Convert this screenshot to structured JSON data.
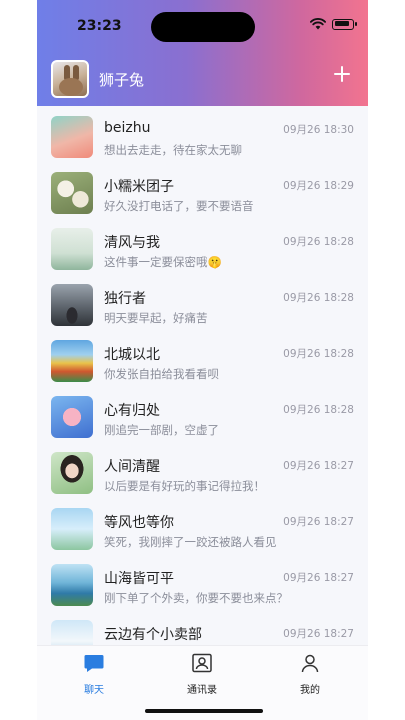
{
  "status_bar": {
    "time": "23:23"
  },
  "header": {
    "username": "狮子兔",
    "add_icon": "plus-icon"
  },
  "chats": [
    {
      "name": "beizhu",
      "time": "09月26 18:30",
      "message": "想出去走走，待在家太无聊"
    },
    {
      "name": "小糯米团子",
      "time": "09月26 18:29",
      "message": "好久没打电话了，要不要语音"
    },
    {
      "name": "清风与我",
      "time": "09月26 18:28",
      "message": "这件事一定要保密哦🤫"
    },
    {
      "name": "独行者",
      "time": "09月26 18:28",
      "message": "明天要早起，好痛苦"
    },
    {
      "name": "北城以北",
      "time": "09月26 18:28",
      "message": "你发张自拍给我看看呗"
    },
    {
      "name": "心有归处",
      "time": "09月26 18:28",
      "message": "刚追完一部剧，空虚了"
    },
    {
      "name": "人间清醒",
      "time": "09月26 18:27",
      "message": "以后要是有好玩的事记得拉我！"
    },
    {
      "name": "等风也等你",
      "time": "09月26 18:27",
      "message": "笑死，我刚摔了一跤还被路人看见"
    },
    {
      "name": "山海皆可平",
      "time": "09月26 18:27",
      "message": "刚下单了个外卖，你要不要也来点？"
    },
    {
      "name": "云边有个小卖部",
      "time": "09月26 18:27",
      "message": ""
    }
  ],
  "tabs": [
    {
      "label": "聊天",
      "icon": "chat-icon",
      "active": true
    },
    {
      "label": "通讯录",
      "icon": "contacts-icon",
      "active": false
    },
    {
      "label": "我的",
      "icon": "profile-icon",
      "active": false
    }
  ],
  "colors": {
    "accent": "#2a7de0",
    "header_start": "#6f7fe8",
    "header_end": "#f2748f"
  }
}
